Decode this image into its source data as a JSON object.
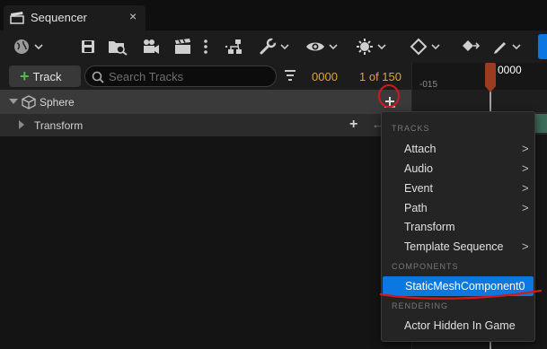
{
  "tab": {
    "title": "Sequencer",
    "close": "×"
  },
  "toolbar": {
    "icons": [
      "world-icon",
      "save-icon",
      "find-asset-icon",
      "render-movie-icon",
      "clapperboard-icon",
      "more-icon",
      "hierarchy-icon",
      "wrench-icon",
      "eye-icon",
      "snap-icon",
      "key-diamond-icon",
      "key-add-icon",
      "pencil-icon"
    ]
  },
  "track_bar": {
    "add_track_label": "Track",
    "search_placeholder": "Search Tracks",
    "current_frame": "0000",
    "frame_count": "1 of 150"
  },
  "timeline": {
    "ruler_start": "-015",
    "playhead_label": "0000"
  },
  "outliner": {
    "rows": [
      {
        "name": "Sphere"
      },
      {
        "name": "Transform"
      }
    ]
  },
  "menu": {
    "tracks_header": "TRACKS",
    "tracks": [
      {
        "label": "Attach",
        "submenu": ">"
      },
      {
        "label": "Audio",
        "submenu": ">"
      },
      {
        "label": "Event",
        "submenu": ">"
      },
      {
        "label": "Path",
        "submenu": ">"
      },
      {
        "label": "Transform"
      },
      {
        "label": "Template Sequence",
        "submenu": ">"
      }
    ],
    "components_header": "COMPONENTS",
    "components": [
      {
        "label": "StaticMeshComponent0",
        "selected": true
      }
    ],
    "rendering_header": "RENDERING",
    "rendering": [
      {
        "label": "Actor Hidden In Game"
      }
    ]
  },
  "colors": {
    "accent_blue": "#0a78e0",
    "frame_orange": "#e0a23a",
    "add_green": "#55b94d",
    "playhead": "#9b3b22",
    "annotation_red": "#d4181d"
  }
}
